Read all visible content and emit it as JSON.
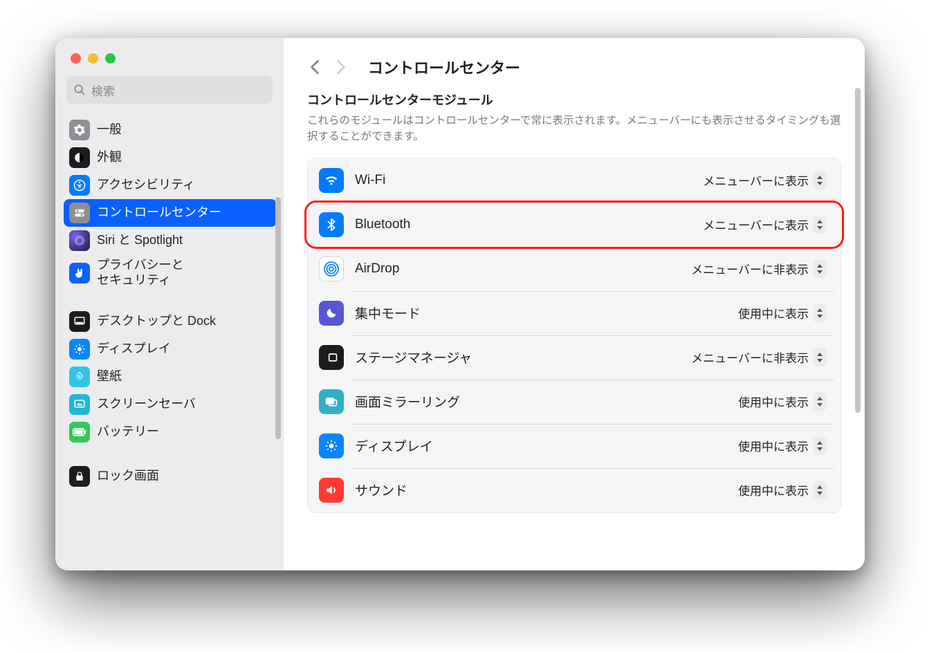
{
  "header": {
    "title": "コントロールセンター"
  },
  "search": {
    "placeholder": "検索"
  },
  "sidebar": {
    "items": [
      {
        "label": "一般"
      },
      {
        "label": "外観"
      },
      {
        "label": "アクセシビリティ"
      },
      {
        "label": "コントロールセンター"
      },
      {
        "label": "Siri と Spotlight"
      },
      {
        "label_line1": "プライバシーと",
        "label_line2": "セキュリティ"
      }
    ],
    "items2": [
      {
        "label": "デスクトップと Dock"
      },
      {
        "label": "ディスプレイ"
      },
      {
        "label": "壁紙"
      },
      {
        "label": "スクリーンセーバ"
      },
      {
        "label": "バッテリー"
      }
    ],
    "items3": [
      {
        "label": "ロック画面"
      }
    ]
  },
  "section": {
    "title": "コントロールセンターモジュール",
    "desc": "これらのモジュールはコントロールセンターで常に表示されます。メニューバーにも表示させるタイミングも選択することができます。"
  },
  "modules": [
    {
      "label": "Wi-Fi",
      "value": "メニューバーに表示"
    },
    {
      "label": "Bluetooth",
      "value": "メニューバーに表示"
    },
    {
      "label": "AirDrop",
      "value": "メニューバーに非表示"
    },
    {
      "label": "集中モード",
      "value": "使用中に表示"
    },
    {
      "label": "ステージマネージャ",
      "value": "メニューバーに非表示"
    },
    {
      "label": "画面ミラーリング",
      "value": "使用中に表示"
    },
    {
      "label": "ディスプレイ",
      "value": "使用中に表示"
    },
    {
      "label": "サウンド",
      "value": "使用中に表示"
    }
  ]
}
